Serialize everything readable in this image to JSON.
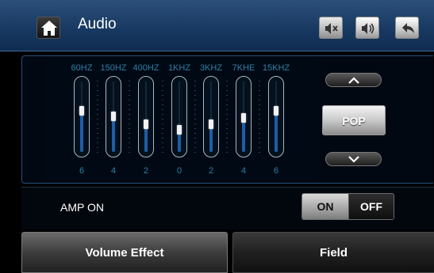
{
  "header": {
    "title": "Audio",
    "home_icon": "home-icon",
    "mute_icon": "speaker-mute-icon",
    "volume_icon": "speaker-volume-icon",
    "back_icon": "back-arrow-icon"
  },
  "equalizer": {
    "bands": [
      {
        "freq": "60HZ",
        "gain": "6",
        "level": 0.57
      },
      {
        "freq": "150HZ",
        "gain": "4",
        "level": 0.49
      },
      {
        "freq": "400HZ",
        "gain": "2",
        "level": 0.38
      },
      {
        "freq": "1KHZ",
        "gain": "0",
        "level": 0.31
      },
      {
        "freq": "3KHZ",
        "gain": "2",
        "level": 0.38
      },
      {
        "freq": "7KHE",
        "gain": "4",
        "level": 0.47
      },
      {
        "freq": "15KHZ",
        "gain": "6",
        "level": 0.57
      }
    ]
  },
  "preset": {
    "label": "POP",
    "up_icon": "chevron-up-icon",
    "down_icon": "chevron-down-icon"
  },
  "amp": {
    "label": "AMP ON",
    "on_label": "ON",
    "off_label": "OFF",
    "state": "ON"
  },
  "tabs": [
    {
      "label": "Volume Effect",
      "active": true
    },
    {
      "label": "Field",
      "active": false
    }
  ],
  "colors": {
    "header": "#183a63",
    "eq_fill": "#1d5ea8",
    "label_teal": "#2d7fa8"
  }
}
